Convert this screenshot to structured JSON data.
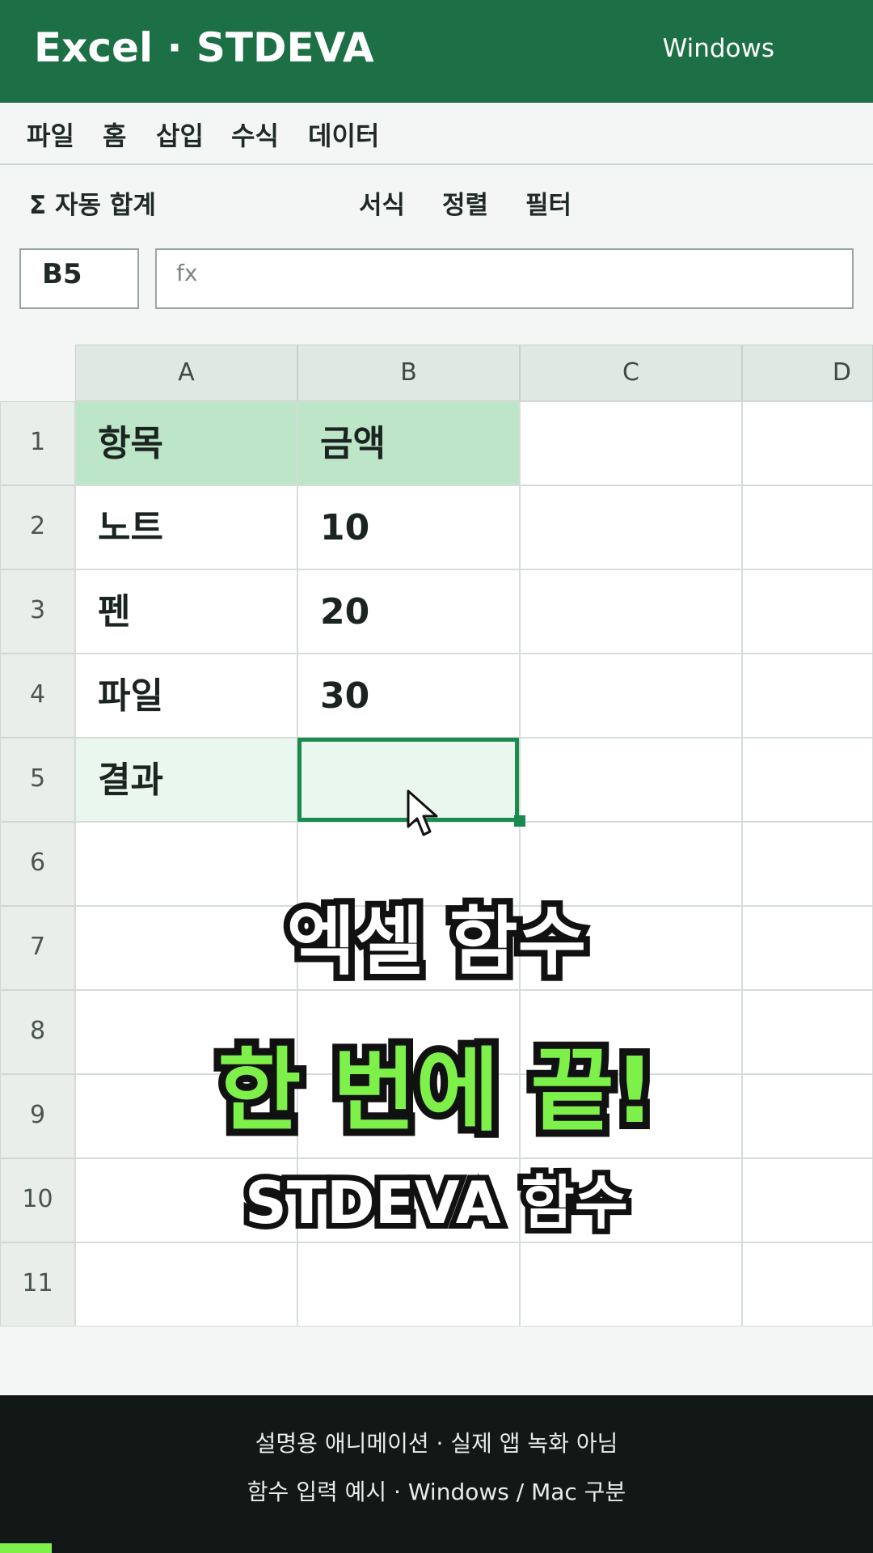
{
  "titlebar": {
    "title": "Excel · STDEVA",
    "os": "Windows"
  },
  "menubar": {
    "items": [
      "파일",
      "홈",
      "삽입",
      "수식",
      "데이터"
    ]
  },
  "ribbon": {
    "autosum": "Σ 자동 합계",
    "format": "서식",
    "sort": "정렬",
    "filter": "필터"
  },
  "formula_bar": {
    "name_box": "B5",
    "fx": "fx",
    "value": ""
  },
  "sheet": {
    "columns": [
      "A",
      "B",
      "C",
      "D"
    ],
    "rows": [
      "1",
      "2",
      "3",
      "4",
      "5",
      "6",
      "7",
      "8",
      "9",
      "10",
      "11"
    ],
    "cells": {
      "A1": "항목",
      "B1": "금액",
      "A2": "노트",
      "B2": "10",
      "A3": "펜",
      "B3": "20",
      "A4": "파일",
      "B4": "30",
      "A5": "결과",
      "B5": ""
    },
    "selected_cell": "B5"
  },
  "overlay": {
    "line1": "엑셀 함수",
    "line2": "한 번에 끝!",
    "line3": "STDEVA 함수"
  },
  "footer": {
    "line1": "설명용 애니메이션 · 실제 앱 녹화 아님",
    "line2": "함수 입력 예시 · Windows / Mac 구분"
  },
  "colors": {
    "brand": "#1d6f45",
    "accent": "#7ef04a",
    "header_fill": "#bde5c8",
    "selection": "#1a8a4e"
  }
}
